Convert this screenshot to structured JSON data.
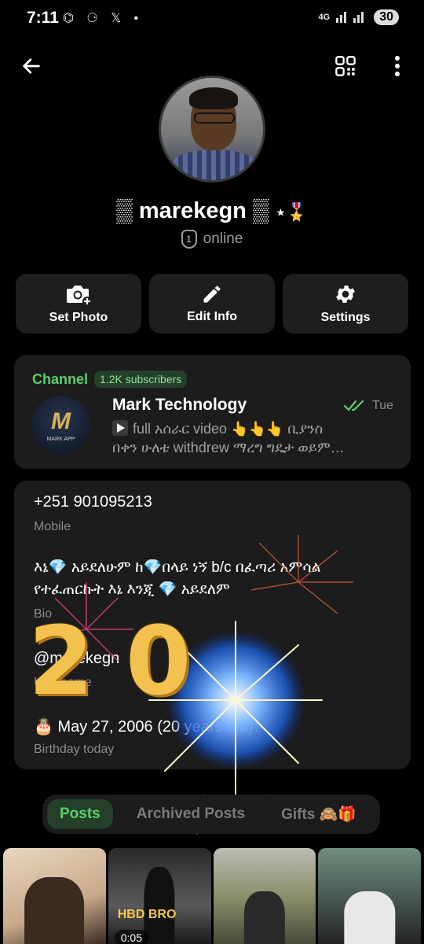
{
  "statusbar": {
    "time": "7:11",
    "notif_icons": "⌬ ⚆ 𝕏 •",
    "network": "4G",
    "battery": "30"
  },
  "topbar": {
    "back_icon": "arrow-left-icon",
    "qr_icon": "qr-code-icon",
    "menu_icon": "more-vertical-icon"
  },
  "profile": {
    "name": "▒ marekegn ▒",
    "name_badges": "⋆🎖️",
    "status_badge": "1",
    "status": "online"
  },
  "actions": [
    {
      "label": "Set Photo",
      "icon": "camera-add-icon"
    },
    {
      "label": "Edit Info",
      "icon": "pencil-icon"
    },
    {
      "label": "Settings",
      "icon": "gear-icon"
    }
  ],
  "channel": {
    "section_title": "Channel",
    "subscribers": "1.2K subscribers",
    "logo_letter": "M",
    "logo_caption": "MARK APP",
    "name": "Mark Technology",
    "time": "Tue",
    "message_line1": "full  አሰራር  video 👆👆👆  ቢያንስ",
    "message_line2": "በቀን ሁለቴ withdrew ማረግ ግዴታ ወይም…",
    "accent": "#5ccf6a"
  },
  "info": {
    "phone": "+251 901095213",
    "phone_label": "Mobile",
    "bio_line1": "እኔ💎 አይደለሁም ከ💎በላይ ነኝ b/c በፈጣሪ አምሳል",
    "bio_line2": "የተፈጠርኩት እኔ እንጂ 💎 አይደለም",
    "bio_label": "Bio",
    "username": "@marekegn",
    "username_label": "Username",
    "birthday": "🎂 May 27, 2006 (20 years old)",
    "birthday_label": "Birthday today"
  },
  "overlay": {
    "balloon_2": "2",
    "balloon_0": "0"
  },
  "tabs": [
    {
      "label": "Posts",
      "active": true
    },
    {
      "label": "Archived Posts",
      "active": false
    },
    {
      "label": "Gifts 🙈🎁",
      "active": false
    }
  ],
  "posts": [
    {
      "caption": "",
      "duration": ""
    },
    {
      "caption": "HBD BRO",
      "duration": "0:05"
    },
    {
      "caption": "",
      "duration": ""
    },
    {
      "caption": "",
      "duration": ""
    }
  ]
}
